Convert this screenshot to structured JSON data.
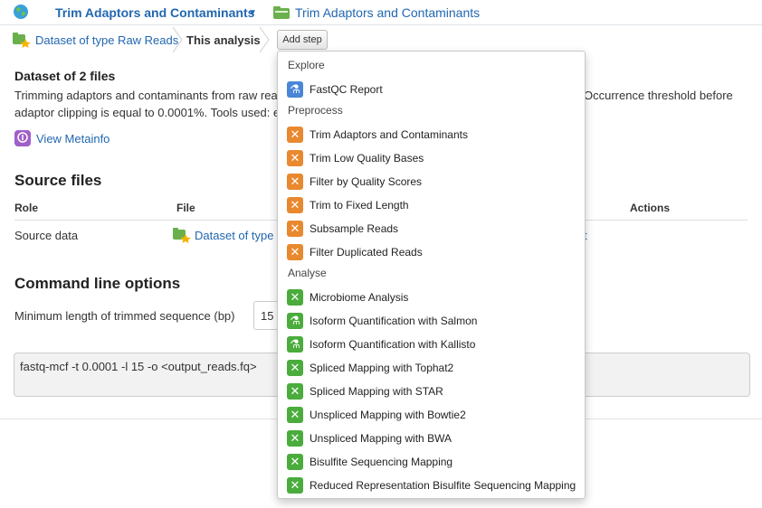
{
  "header": {
    "app_title": "Trim Adaptors and Contaminants",
    "project_link": "Trim Adaptors and Contaminants"
  },
  "breadcrumb": {
    "first": "Dataset of type Raw Reads",
    "current": "This analysis",
    "add_step": "Add step"
  },
  "main": {
    "dataset_heading": "Dataset of 2 files",
    "desc_line1_left": "Trimming adaptors and contaminants from raw rea",
    "desc_line1_right": "Occurrence threshold before",
    "desc_line2_left": "adaptor clipping is equal to 0.0001%. Tools used: e",
    "desc_line2_right": "",
    "view_metainfo": "View Metainfo",
    "source_heading": "Source files",
    "table": {
      "headers": {
        "role": "Role",
        "file": "File",
        "actions": "Actions"
      },
      "row": {
        "role": "Source data",
        "file": "Dataset of type",
        "action_fragment": "t"
      }
    },
    "cmd_heading": "Command line options",
    "min_length_label": "Minimum length of trimmed sequence (bp)",
    "min_length_value": "15",
    "command": "fastq-mcf -t 0.0001 -l 15 -o <output_reads.fq>"
  },
  "dropdown": {
    "sections": [
      {
        "title": "Explore",
        "items": [
          {
            "label": "FastQC Report",
            "color": "blue",
            "icon": "microscope-icon"
          }
        ]
      },
      {
        "title": "Preprocess",
        "items": [
          {
            "label": "Trim Adaptors and Contaminants",
            "color": "orange",
            "icon": "dna-icon"
          },
          {
            "label": "Trim Low Quality Bases",
            "color": "orange",
            "icon": "dna-icon"
          },
          {
            "label": "Filter by Quality Scores",
            "color": "orange",
            "icon": "dna-icon"
          },
          {
            "label": "Trim to Fixed Length",
            "color": "orange",
            "icon": "dna-icon"
          },
          {
            "label": "Subsample Reads",
            "color": "orange",
            "icon": "dna-icon"
          },
          {
            "label": "Filter Duplicated Reads",
            "color": "orange",
            "icon": "dna-icon"
          }
        ]
      },
      {
        "title": "Analyse",
        "items": [
          {
            "label": "Microbiome Analysis",
            "color": "green",
            "icon": "dna-icon"
          },
          {
            "label": "Isoform Quantification with Salmon",
            "color": "green",
            "icon": "microscope-icon"
          },
          {
            "label": "Isoform Quantification with Kallisto",
            "color": "green",
            "icon": "microscope-icon"
          },
          {
            "label": "Spliced Mapping with Tophat2",
            "color": "green",
            "icon": "dna-icon"
          },
          {
            "label": "Spliced Mapping with STAR",
            "color": "green",
            "icon": "dna-icon"
          },
          {
            "label": "Unspliced Mapping with Bowtie2",
            "color": "green",
            "icon": "dna-icon"
          },
          {
            "label": "Unspliced Mapping with BWA",
            "color": "green",
            "icon": "dna-icon"
          },
          {
            "label": "Bisulfite Sequencing Mapping",
            "color": "green",
            "icon": "dna-icon"
          },
          {
            "label": "Reduced Representation Bisulfite Sequencing Mapping",
            "color": "green",
            "icon": "dna-icon"
          }
        ]
      }
    ]
  },
  "colors": {
    "link": "#2267b1",
    "blue_icon": "#4a86d6",
    "orange_icon": "#e8892f",
    "green_icon": "#4aac3c",
    "metainfo_icon": "#a15fc8"
  }
}
